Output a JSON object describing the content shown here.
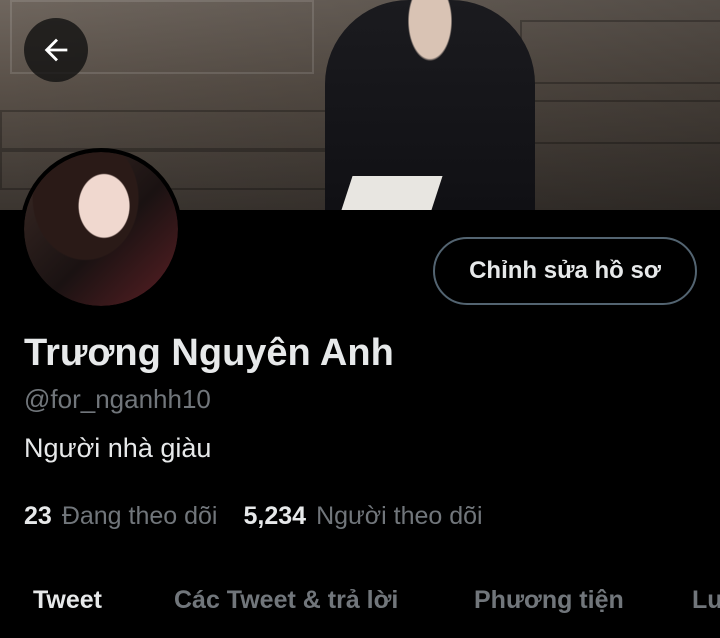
{
  "header": {
    "back_icon": "arrow-left-icon"
  },
  "profile": {
    "display_name": "Trương Nguyên Anh",
    "handle": "@for_nganhh10",
    "bio": "Người nhà giàu",
    "edit_profile_label": "Chỉnh sửa hồ sơ",
    "following_count": "23",
    "following_label": "Đang theo dõi",
    "followers_count": "5,234",
    "followers_label": "Người theo dõi"
  },
  "tabs": [
    {
      "label": "Tweet",
      "active": true
    },
    {
      "label": "Các Tweet & trả lời",
      "active": false
    },
    {
      "label": "Phương tiện",
      "active": false
    },
    {
      "label": "Lu",
      "active": false
    }
  ],
  "colors": {
    "background": "#000000",
    "text_primary": "#e7e9ea",
    "text_secondary": "#71767b",
    "border": "#536471"
  }
}
